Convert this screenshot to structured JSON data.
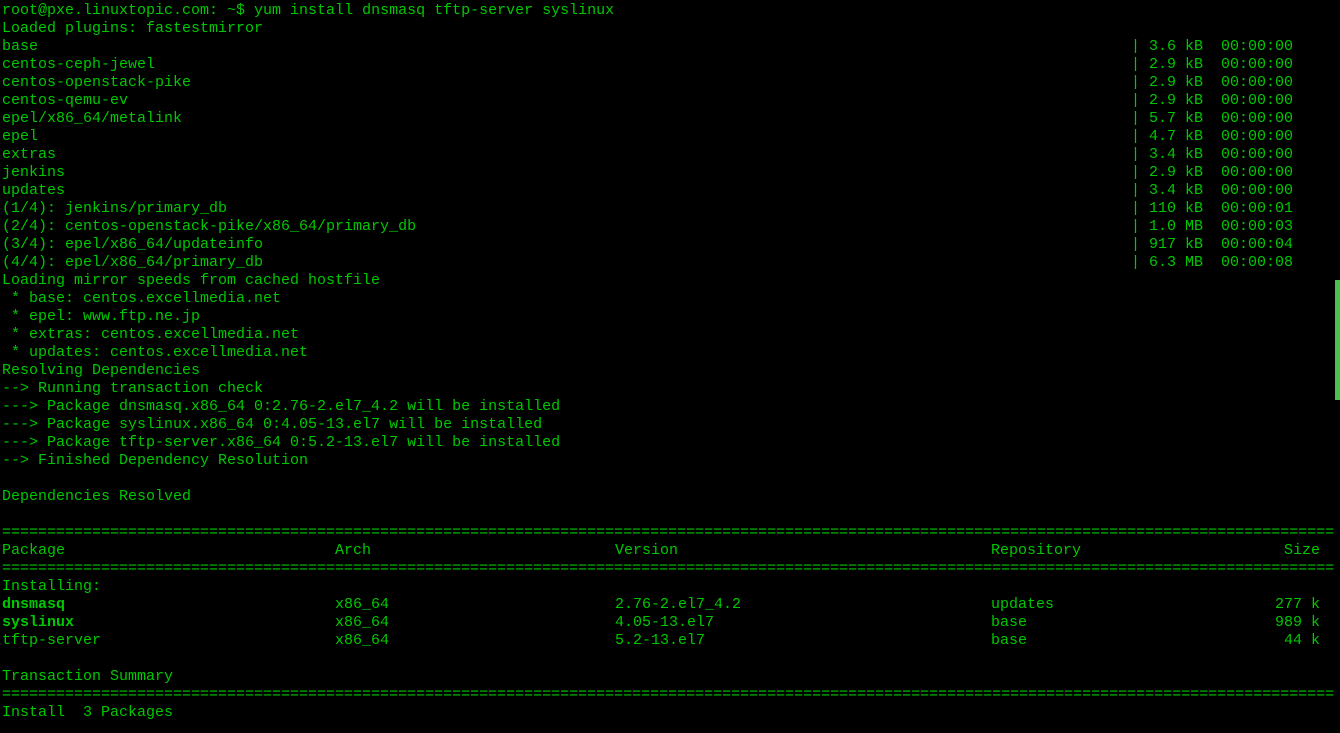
{
  "prompt_user": "root@pxe.linuxtopic.com: ~$",
  "command": " yum install dnsmasq tftp-server syslinux",
  "loaded_plugins": "Loaded plugins: fastestmirror",
  "repos": [
    {
      "name": "base",
      "size": "3.6 kB",
      "time": "00:00:00"
    },
    {
      "name": "centos-ceph-jewel",
      "size": "2.9 kB",
      "time": "00:00:00"
    },
    {
      "name": "centos-openstack-pike",
      "size": "2.9 kB",
      "time": "00:00:00"
    },
    {
      "name": "centos-qemu-ev",
      "size": "2.9 kB",
      "time": "00:00:00"
    },
    {
      "name": "epel/x86_64/metalink",
      "size": "5.7 kB",
      "time": "00:00:00"
    },
    {
      "name": "epel",
      "size": "4.7 kB",
      "time": "00:00:00"
    },
    {
      "name": "extras",
      "size": "3.4 kB",
      "time": "00:00:00"
    },
    {
      "name": "jenkins",
      "size": "2.9 kB",
      "time": "00:00:00"
    },
    {
      "name": "updates",
      "size": "3.4 kB",
      "time": "00:00:00"
    },
    {
      "name": "(1/4): jenkins/primary_db",
      "size": "110 kB",
      "time": "00:00:01"
    },
    {
      "name": "(2/4): centos-openstack-pike/x86_64/primary_db",
      "size": "1.0 MB",
      "time": "00:00:03"
    },
    {
      "name": "(3/4): epel/x86_64/updateinfo",
      "size": "917 kB",
      "time": "00:00:04"
    },
    {
      "name": "(4/4): epel/x86_64/primary_db",
      "size": "6.3 MB",
      "time": "00:00:08"
    }
  ],
  "mirror_speeds": "Loading mirror speeds from cached hostfile",
  "mirrors": [
    " * base: centos.excellmedia.net",
    " * epel: www.ftp.ne.jp",
    " * extras: centos.excellmedia.net",
    " * updates: centos.excellmedia.net"
  ],
  "resolving": "Resolving Dependencies",
  "dep_lines": [
    "--> Running transaction check",
    "---> Package dnsmasq.x86_64 0:2.76-2.el7_4.2 will be installed",
    "---> Package syslinux.x86_64 0:4.05-13.el7 will be installed",
    "---> Package tftp-server.x86_64 0:5.2-13.el7 will be installed",
    "--> Finished Dependency Resolution"
  ],
  "deps_resolved": "Dependencies Resolved",
  "table_headers": {
    "package": " Package",
    "arch": "Arch",
    "version": "Version",
    "repo": "Repository",
    "size": "Size"
  },
  "installing_label": "Installing:",
  "packages": [
    {
      "name": " dnsmasq",
      "bold": true,
      "arch": "x86_64",
      "version": "2.76-2.el7_4.2",
      "repo": "updates",
      "size": "277 k"
    },
    {
      "name": " syslinux",
      "bold": true,
      "arch": "x86_64",
      "version": "4.05-13.el7",
      "repo": "base",
      "size": "989 k"
    },
    {
      "name": " tftp-server",
      "bold": false,
      "arch": "x86_64",
      "version": "5.2-13.el7",
      "repo": "base",
      "size": "44 k"
    }
  ],
  "transaction_summary": "Transaction Summary",
  "install_line": "Install  3 Packages",
  "divider": "===================================================================================================================================================="
}
